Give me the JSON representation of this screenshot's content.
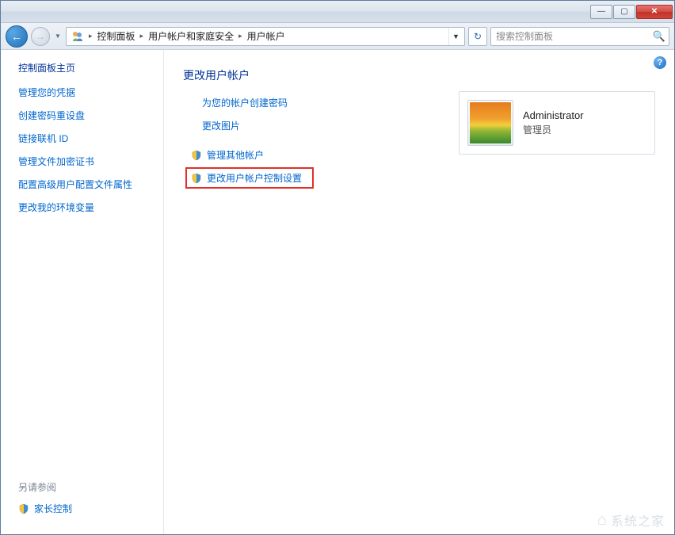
{
  "titlebar": {
    "minimize": "—",
    "maximize": "▢",
    "close": "✕"
  },
  "nav": {
    "back": "←",
    "forward": "→",
    "dropdown": "▼",
    "addr_drop": "▼",
    "refresh": "↻"
  },
  "breadcrumbs": {
    "sep": "▸",
    "items": [
      "控制面板",
      "用户帐户和家庭安全",
      "用户帐户"
    ]
  },
  "search": {
    "placeholder": "搜索控制面板",
    "icon": "🔍"
  },
  "sidebar": {
    "title": "控制面板主页",
    "links": [
      "管理您的凭据",
      "创建密码重设盘",
      "链接联机 ID",
      "管理文件加密证书",
      "配置高级用户配置文件属性",
      "更改我的环境变量"
    ],
    "see_also": "另请参阅",
    "bottom_link": "家长控制"
  },
  "main": {
    "heading": "更改用户帐户",
    "actions": [
      "为您的帐户创建密码",
      "更改图片"
    ],
    "admin_actions": [
      "管理其他帐户",
      "更改用户帐户控制设置"
    ],
    "help": "?"
  },
  "account": {
    "name": "Administrator",
    "role": "管理员"
  },
  "watermark": {
    "logo": "⌂",
    "text": "系统之家"
  }
}
